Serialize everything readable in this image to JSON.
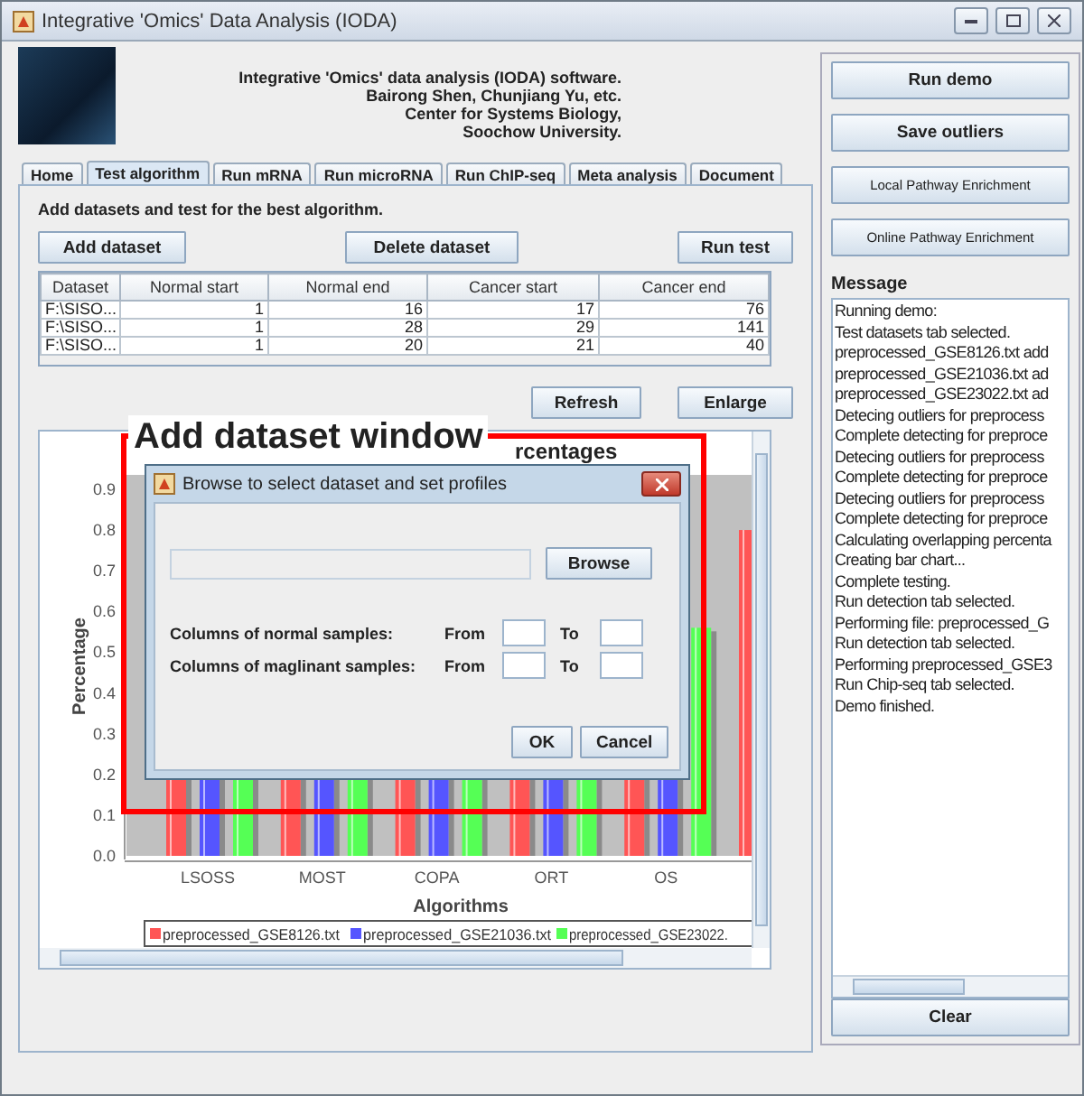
{
  "window": {
    "title": "Integrative 'Omics' Data Analysis (IODA)"
  },
  "header": {
    "credits": [
      "Integrative 'Omics' data analysis (IODA) software.",
      "Bairong Shen, Chunjiang Yu, etc.",
      "Center for Systems Biology,",
      "Soochow University."
    ]
  },
  "tabs": [
    {
      "label": "Home",
      "selected": false
    },
    {
      "label": "Test algorithm",
      "selected": true
    },
    {
      "label": "Run mRNA",
      "selected": false
    },
    {
      "label": "Run microRNA",
      "selected": false
    },
    {
      "label": "Run ChIP-seq",
      "selected": false
    },
    {
      "label": "Meta analysis",
      "selected": false
    },
    {
      "label": "Document",
      "selected": false
    }
  ],
  "test_panel": {
    "instruction": "Add datasets and test for the best algorithm.",
    "buttons": [
      "Add dataset",
      "Delete dataset",
      "Run test"
    ],
    "table": {
      "columns": [
        "Dataset",
        "Normal start",
        "Normal end",
        "Cancer start",
        "Cancer end"
      ],
      "rows": [
        [
          "F:\\SISO...",
          "1",
          "16",
          "17",
          "76"
        ],
        [
          "F:\\SISO...",
          "1",
          "28",
          "29",
          "141"
        ],
        [
          "F:\\SISO...",
          "1",
          "20",
          "21",
          "40"
        ]
      ]
    },
    "chart_buttons": [
      "Refresh",
      "Enlarge"
    ],
    "chart": {
      "title_fragment": "rcentages",
      "ylabel": "Percentage",
      "xlabel": "Algorithms",
      "yticks": [
        "0.9",
        "0.8",
        "0.7",
        "0.6",
        "0.5",
        "0.4",
        "0.3",
        "0.2",
        "0.1",
        "0.0"
      ],
      "categories": [
        "LSOSS",
        "MOST",
        "COPA",
        "ORT",
        "OS"
      ],
      "legend": [
        {
          "label": "preprocessed_GSE8126.txt",
          "color": "#ff5555"
        },
        {
          "label": "preprocessed_GSE21036.txt",
          "color": "#5555ff"
        },
        {
          "label": "preprocessed_GSE23022.",
          "color": "#55ff55"
        }
      ]
    }
  },
  "annotation": {
    "label": "Add dataset window"
  },
  "dialog": {
    "title": "Browse to select dataset and set profiles",
    "browse_button": "Browse",
    "rows": [
      {
        "label": "Columns of normal samples:",
        "from": "From",
        "to": "To"
      },
      {
        "label": "Columns of maglinant samples:",
        "from": "From",
        "to": "To"
      }
    ],
    "buttons": [
      "OK",
      "Cancel"
    ]
  },
  "side_panel": {
    "buttons": [
      {
        "label": "Run demo",
        "kind": "large"
      },
      {
        "label": "Save outliers",
        "kind": "large"
      },
      {
        "label": "Local Pathway Enrichment",
        "kind": "small"
      },
      {
        "label": "Online Pathway Enrichment",
        "kind": "small"
      }
    ],
    "message_label": "Message",
    "messages": [
      "Running demo:",
      "Test datasets tab selected.",
      "preprocessed_GSE8126.txt add",
      "preprocessed_GSE21036.txt ad",
      "preprocessed_GSE23022.txt ad",
      "Detecing outliers for preprocess",
      "Complete detecting for preproce",
      "Detecing outliers for preprocess",
      "Complete detecting for preproce",
      "Detecing outliers for preprocess",
      "Complete detecting for preproce",
      "Calculating overlapping percenta",
      "Creating bar chart...",
      "Complete testing.",
      "Run detection tab selected.",
      "Performing file: preprocessed_G",
      "Run detection tab selected.",
      "Performing preprocessed_GSE3",
      "Run Chip-seq tab selected.",
      "Demo finished."
    ],
    "clear_button": "Clear"
  }
}
